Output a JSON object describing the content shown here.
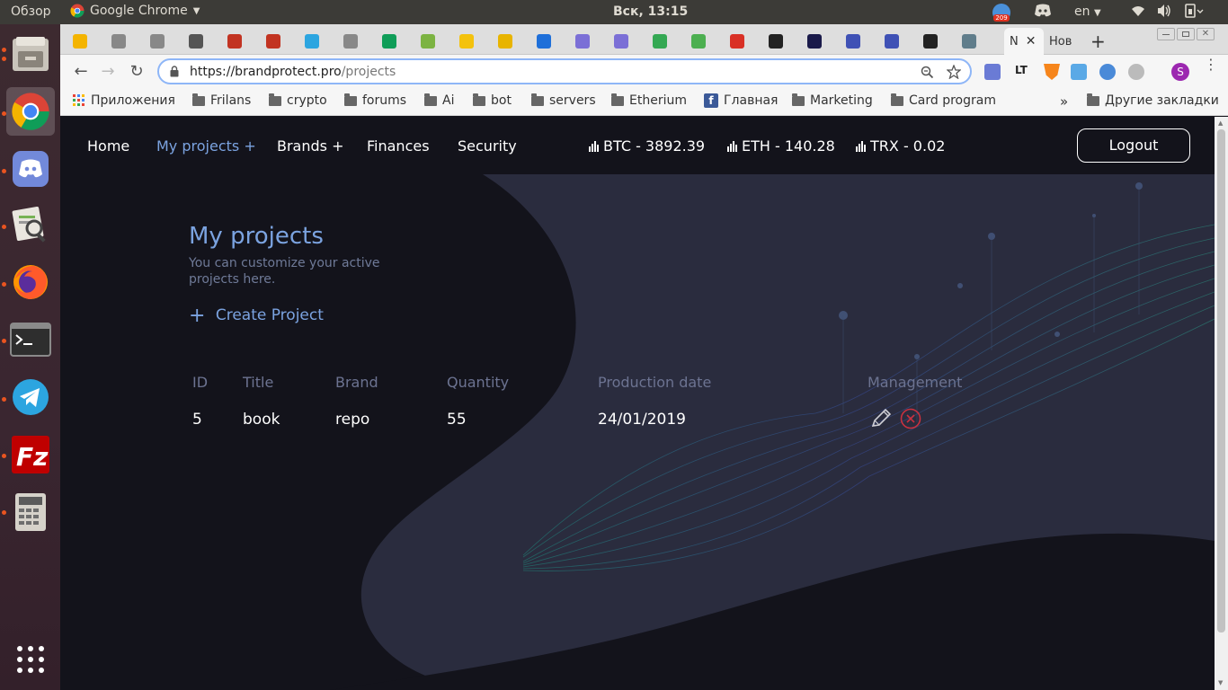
{
  "topbar": {
    "activities": "Обзор",
    "app_name": "Google Chrome",
    "clock": "Вск, 13:15",
    "badge": "209",
    "lang": "en"
  },
  "tabs": {
    "active_title": "N",
    "new_title": "Нов"
  },
  "omnibox": {
    "url_domain": "https://brandprotect.pro",
    "url_path": "/projects",
    "profile_letter": "S"
  },
  "bookmarks": {
    "items": [
      "Приложения",
      "Frilans",
      "crypto",
      "forums",
      "Ai",
      "bot",
      "servers",
      "Etherium",
      "Главная",
      "Marketing",
      "Card program"
    ],
    "more": "»",
    "other": "Другие закладки"
  },
  "site": {
    "nav": {
      "home": "Home",
      "my_projects": "My projects +",
      "brands": "Brands +",
      "finances": "Finances",
      "security": "Security"
    },
    "tickers": [
      "BTC - 3892.39",
      "ETH - 140.28",
      "TRX - 0.02"
    ],
    "logout": "Logout",
    "page_title": "My projects",
    "subtitle": "You can customize your active projects here.",
    "create_project": "Create Project",
    "create_icon": "+",
    "table": {
      "headers": [
        "ID",
        "Title",
        "Brand",
        "Quantity",
        "Production date",
        "Management"
      ],
      "rows": [
        {
          "id": "5",
          "title": "book",
          "brand": "repo",
          "quantity": "55",
          "date": "24/01/2019"
        }
      ]
    }
  },
  "colors": {
    "page_bg": "#13131b",
    "accent": "#7ba3e0",
    "delete": "#c8313f",
    "ubuntu_orange": "#e95420"
  }
}
